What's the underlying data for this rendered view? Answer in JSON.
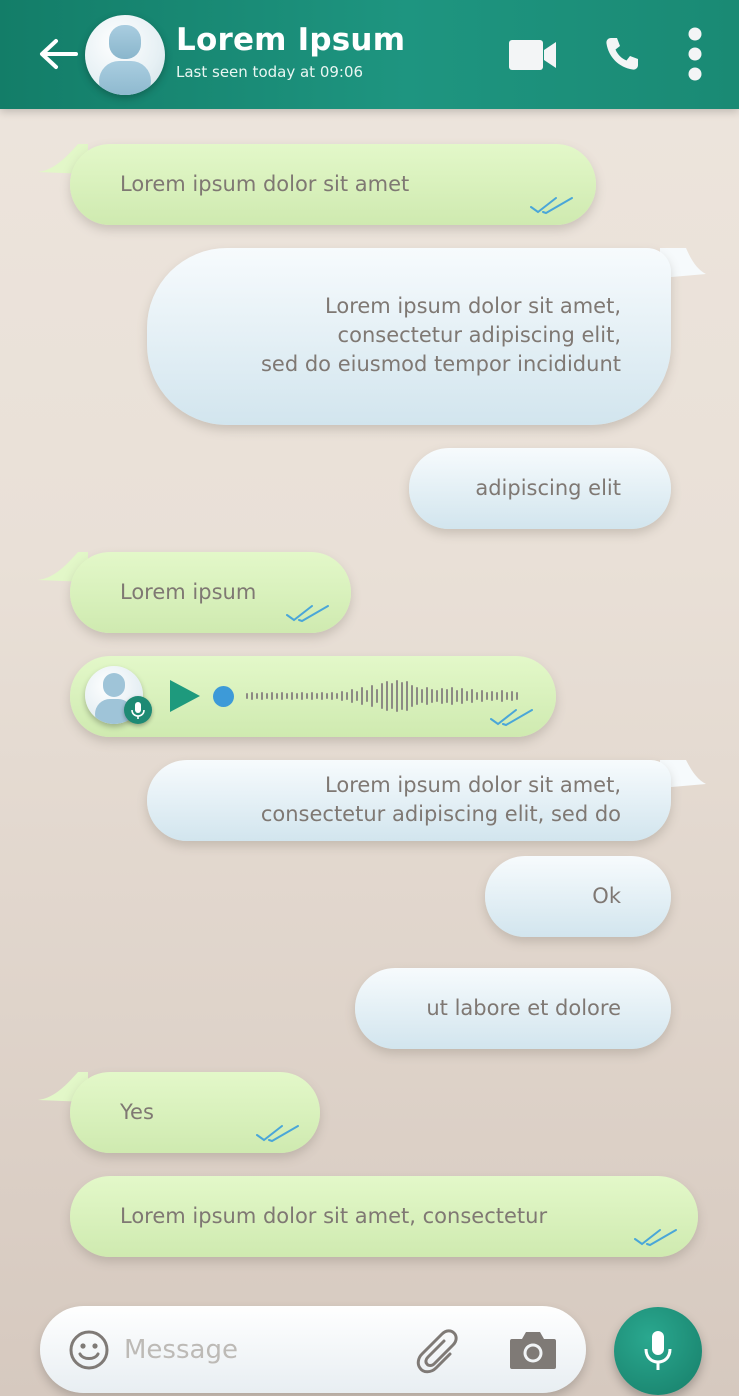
{
  "header": {
    "contact_name": "Lorem Ipsum",
    "status": "Last seen today at 09:06",
    "icons": [
      "back-arrow-icon",
      "video-call-icon",
      "phone-icon",
      "more-options-icon"
    ]
  },
  "colors": {
    "header": "#1a8a74",
    "received_bubble": "#d9f1bd",
    "sent_bubble": "#e6f1f6",
    "ticks": "#4aa6d8",
    "text": "#7f7873"
  },
  "messages": [
    {
      "direction": "received",
      "lines": [
        "Lorem ipsum dolor sit amet"
      ],
      "status": "read"
    },
    {
      "direction": "sent",
      "lines": [
        "Lorem ipsum dolor sit amet,",
        "consectetur adipiscing elit,",
        "sed do eiusmod tempor incididunt"
      ]
    },
    {
      "direction": "sent",
      "lines": [
        "adipiscing elit"
      ]
    },
    {
      "direction": "received",
      "lines": [
        "Lorem ipsum"
      ],
      "status": "read"
    },
    {
      "direction": "received",
      "type": "voice",
      "status": "read"
    },
    {
      "direction": "sent",
      "lines": [
        "Lorem ipsum dolor sit amet,",
        "consectetur adipiscing elit, sed do"
      ]
    },
    {
      "direction": "sent",
      "lines": [
        "Ok"
      ]
    },
    {
      "direction": "sent",
      "lines": [
        "ut labore et dolore"
      ]
    },
    {
      "direction": "received",
      "lines": [
        "Yes"
      ],
      "status": "read"
    },
    {
      "direction": "received",
      "lines": [
        "Lorem ipsum dolor sit amet, consectetur"
      ],
      "status": "read"
    }
  ],
  "composer": {
    "placeholder": "Message",
    "icons": [
      "emoji-icon",
      "attachment-icon",
      "camera-icon",
      "microphone-icon"
    ]
  }
}
